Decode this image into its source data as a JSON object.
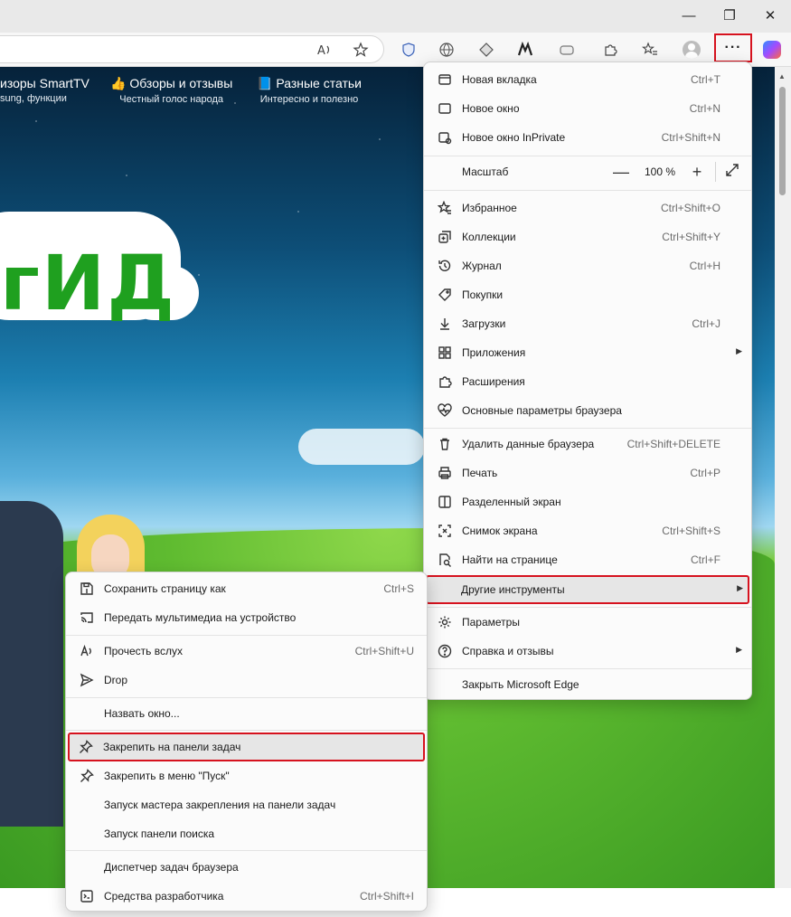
{
  "window": {
    "minimize": "—",
    "maximize": "❐",
    "close": "✕"
  },
  "toolbar": {
    "read_aloud_icon": "read-aloud-icon",
    "favorite_icon": "star-icon",
    "more_label": "···"
  },
  "page": {
    "nav": [
      {
        "title": "изоры SmartTV",
        "sub": "sung, функции"
      },
      {
        "title": "Обзоры и отзывы",
        "sub": "Честный голос народа"
      },
      {
        "title": "Разные статьи",
        "sub": "Интересно и полезно"
      }
    ],
    "logo_text": "гИД"
  },
  "main_menu": {
    "items": [
      {
        "label": "Новая вкладка",
        "shortcut": "Ctrl+T"
      },
      {
        "label": "Новое окно",
        "shortcut": "Ctrl+N"
      },
      {
        "label": "Новое окно InPrivate",
        "shortcut": "Ctrl+Shift+N"
      },
      {
        "label": "Масштаб",
        "shortcut": ""
      },
      {
        "label": "Избранное",
        "shortcut": "Ctrl+Shift+O"
      },
      {
        "label": "Коллекции",
        "shortcut": "Ctrl+Shift+Y"
      },
      {
        "label": "Журнал",
        "shortcut": "Ctrl+H"
      },
      {
        "label": "Покупки",
        "shortcut": ""
      },
      {
        "label": "Загрузки",
        "shortcut": "Ctrl+J"
      },
      {
        "label": "Приложения",
        "shortcut": ""
      },
      {
        "label": "Расширения",
        "shortcut": ""
      },
      {
        "label": "Основные параметры браузера",
        "shortcut": ""
      },
      {
        "label": "Удалить данные браузера",
        "shortcut": "Ctrl+Shift+DELETE"
      },
      {
        "label": "Печать",
        "shortcut": "Ctrl+P"
      },
      {
        "label": "Разделенный экран",
        "shortcut": ""
      },
      {
        "label": "Снимок экрана",
        "shortcut": "Ctrl+Shift+S"
      },
      {
        "label": "Найти на странице",
        "shortcut": "Ctrl+F"
      },
      {
        "label": "Другие инструменты",
        "shortcut": ""
      },
      {
        "label": "Параметры",
        "shortcut": ""
      },
      {
        "label": "Справка и отзывы",
        "shortcut": ""
      },
      {
        "label": "Закрыть Microsoft Edge",
        "shortcut": ""
      }
    ],
    "zoom": {
      "minus": "—",
      "value": "100 %",
      "plus": "+"
    }
  },
  "sub_menu": {
    "items": [
      {
        "label": "Сохранить страницу как",
        "shortcut": "Ctrl+S"
      },
      {
        "label": "Передать мультимедиа на устройство",
        "shortcut": ""
      },
      {
        "label": "Прочесть вслух",
        "shortcut": "Ctrl+Shift+U"
      },
      {
        "label": "Drop",
        "shortcut": ""
      },
      {
        "label": "Назвать окно...",
        "shortcut": ""
      },
      {
        "label": "Закрепить на панели задач",
        "shortcut": ""
      },
      {
        "label": "Закрепить в меню \"Пуск\"",
        "shortcut": ""
      },
      {
        "label": "Запуск мастера закрепления на панели задач",
        "shortcut": ""
      },
      {
        "label": "Запуск панели поиска",
        "shortcut": ""
      },
      {
        "label": "Диспетчер задач браузера",
        "shortcut": ""
      },
      {
        "label": "Средства разработчика",
        "shortcut": "Ctrl+Shift+I"
      }
    ]
  },
  "colors": {
    "highlight_border": "#d6121e",
    "menu_bg": "#fbfbfb"
  }
}
